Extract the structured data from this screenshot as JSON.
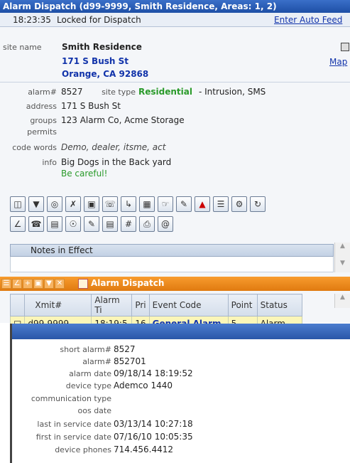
{
  "window": {
    "title": "Alarm Dispatch  (d99-9999, Smith Residence, Areas: 1, 2)"
  },
  "status": {
    "time": "18:23:35",
    "lock_text": "Locked for Dispatch",
    "auto_feed_link": "Enter Auto Feed"
  },
  "site": {
    "name_label": "site name",
    "name": "Smith Residence",
    "street": "171 S Bush St",
    "city_state_zip": "Orange, CA 92868",
    "map_link": "Map"
  },
  "account": {
    "alarm_label": "alarm#",
    "alarm_value": "8527",
    "site_type_label": "site type",
    "site_type_value": "Residential",
    "site_type_suffix": "- Intrusion, SMS",
    "address_label": "address",
    "address_value": "171 S Bush St",
    "groups_label": "groups",
    "groups_value": "123 Alarm Co, Acme Storage",
    "permits_label": "permits",
    "code_words_label": "code words",
    "code_words_value": "Demo, dealer, itsme, act",
    "info_label": "info",
    "info_line1": "Big Dogs in the Back yard",
    "info_line2": "Be careful!"
  },
  "notes": {
    "header": "Notes in Effect"
  },
  "dispatch_panel": {
    "title": "Alarm Dispatch"
  },
  "grid": {
    "columns": [
      "Xmit#",
      "Alarm Ti",
      "Pri",
      "Event Code",
      "Point",
      "Status"
    ],
    "rows": [
      {
        "xmit": "d99-9999",
        "alarm_time": "18:19:5",
        "pri": "16",
        "event": "General Alarm",
        "point": "5",
        "status": "Alarm"
      }
    ]
  },
  "details": [
    {
      "label": "short alarm#",
      "value": "8527"
    },
    {
      "label": "alarm#",
      "value": "852701"
    },
    {
      "label": "alarm date",
      "value": "09/18/14 18:19:52"
    },
    {
      "label": "device type",
      "value": "Ademco 1440"
    },
    {
      "label": "communication type",
      "value": ""
    },
    {
      "label": "oos date",
      "value": ""
    },
    {
      "label": "last in service date",
      "value": "03/13/14 10:27:18"
    },
    {
      "label": "first in service date",
      "value": "07/16/10 10:05:35"
    },
    {
      "label": "device phones",
      "value": "714.456.4412"
    }
  ],
  "colors": {
    "title_bar": "#1e4fa6",
    "panel_header": "#e07a10",
    "row_highlight": "#fbf6b8",
    "site_type": "#2a9a2a"
  }
}
